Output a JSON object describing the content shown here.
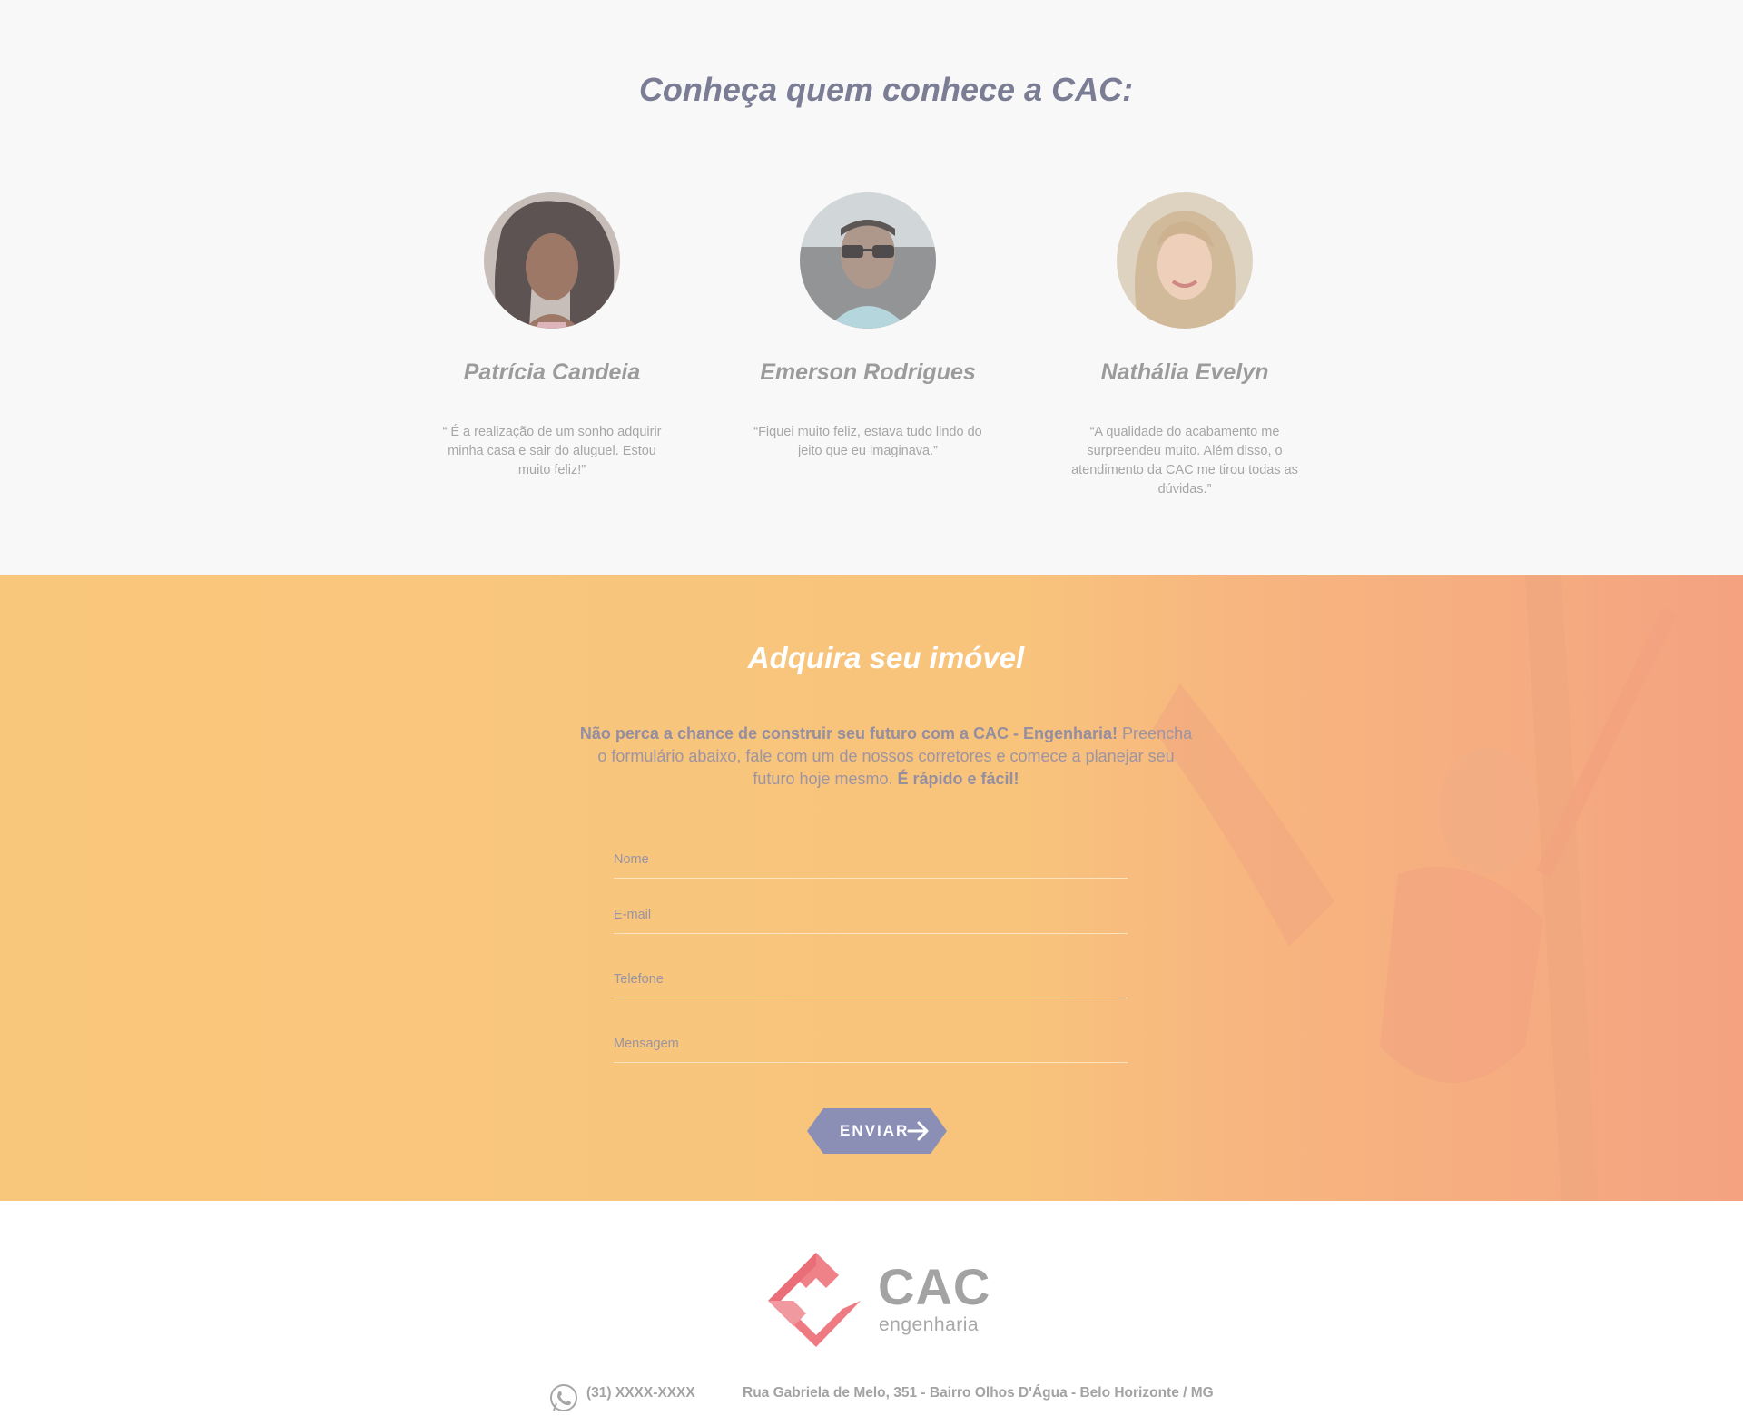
{
  "testimonials": {
    "title": "Conheça quem conhece a CAC:",
    "people": [
      {
        "name": "Patrícia Candeia",
        "quote": "“ É a realização de um sonho adquirir minha casa e sair do aluguel. Estou muito feliz!”"
      },
      {
        "name": "Emerson Rodrigues",
        "quote": "“Fiquei muito feliz, estava tudo lindo do jeito que eu imaginava.”"
      },
      {
        "name": "Nathália Evelyn",
        "quote": "“A qualidade do acabamento me surpreendeu muito. Além disso, o atendimento da CAC me tirou todas as dúvidas.”"
      }
    ]
  },
  "contact_form": {
    "title": "Adquira seu imóvel",
    "intro_bold": "Não perca a chance de construir seu futuro com a CAC - Engenharia!",
    "intro_text": "Preencha o formulário abaixo, fale com um de nossos corretores e comece a planejar seu futuro hoje mesmo.",
    "intro_bold_end": "É rápido e fácil!",
    "fields": {
      "name_placeholder": "Nome",
      "email_placeholder": "E-mail",
      "phone_placeholder": "Telefone",
      "message_placeholder": "Mensagem"
    },
    "submit_label": "ENVIAR"
  },
  "footer": {
    "logo_word": "CAC",
    "logo_sub": "engenharia",
    "phone": "(31) XXXX-XXXX",
    "address": "Rua Gabriela de Melo, 351 - Bairro Olhos D'Água - Belo Horizonte / MG"
  },
  "colors": {
    "heading": "#7b7d95",
    "form_bg": "#f9c77c",
    "button": "#8b8fb6",
    "logo_red": "#ee7b82"
  }
}
